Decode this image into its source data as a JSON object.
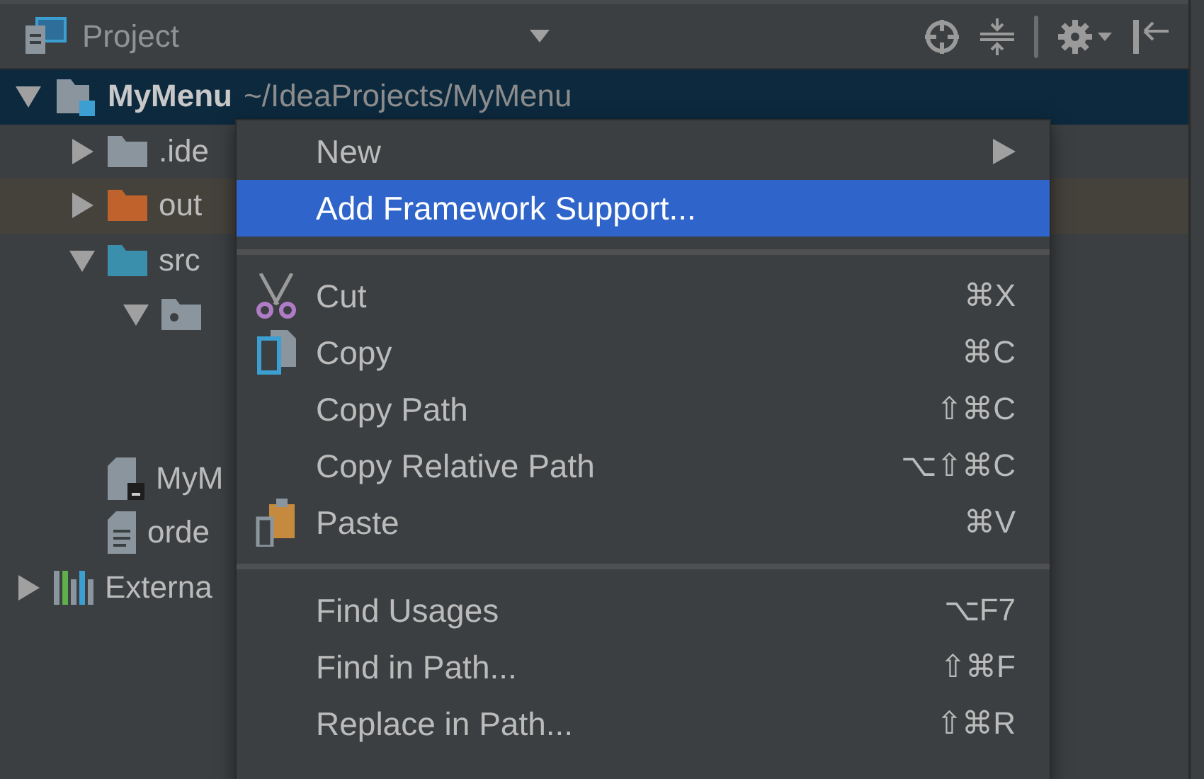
{
  "panel": {
    "title": "Project"
  },
  "tree": [
    {
      "label": "MyMenu",
      "path": "~/IdeaProjects/MyMenu",
      "kind": "module",
      "expanded": true,
      "selected": true,
      "children": [
        {
          "label": ".ide",
          "kind": "folder",
          "color": "#8a959e",
          "expanded": false,
          "selected": false
        },
        {
          "label": "out",
          "kind": "folder",
          "color": "#c0622b",
          "expanded": false,
          "selected": false,
          "highlighted": true
        },
        {
          "label": "src",
          "kind": "folder",
          "color": "#3a8fad",
          "expanded": true,
          "selected": false,
          "children": [
            {
              "kind": "package",
              "expanded": true,
              "selected": false
            }
          ]
        },
        {
          "label": "MyM",
          "kind": "script-file",
          "selected": false
        },
        {
          "label": "orde",
          "kind": "text-file",
          "selected": false
        }
      ]
    },
    {
      "label": "Externa",
      "kind": "libraries",
      "expanded": false,
      "selected": false
    }
  ],
  "menu": [
    {
      "kind": "item",
      "label": "New",
      "submenu": true,
      "selected": false
    },
    {
      "kind": "item",
      "label": "Add Framework Support...",
      "selected": true
    },
    {
      "kind": "separator"
    },
    {
      "kind": "cut",
      "label": "Cut",
      "shortcut": "⌘X",
      "selected": false
    },
    {
      "kind": "copy",
      "label": "Copy",
      "shortcut": "⌘C",
      "selected": false
    },
    {
      "kind": "item",
      "label": "Copy Path",
      "shortcut": "⇧⌘C",
      "selected": false
    },
    {
      "kind": "item",
      "label": "Copy Relative Path",
      "shortcut": "⌥⇧⌘C",
      "selected": false
    },
    {
      "kind": "paste",
      "label": "Paste",
      "shortcut": "⌘V",
      "selected": false
    },
    {
      "kind": "separator"
    },
    {
      "kind": "item",
      "label": "Find Usages",
      "shortcut": "⌥F7",
      "selected": false
    },
    {
      "kind": "item",
      "label": "Find in Path...",
      "shortcut": "⇧⌘F",
      "selected": false
    },
    {
      "kind": "item",
      "label": "Replace in Path...",
      "shortcut": "⇧⌘R",
      "selected": false
    }
  ]
}
